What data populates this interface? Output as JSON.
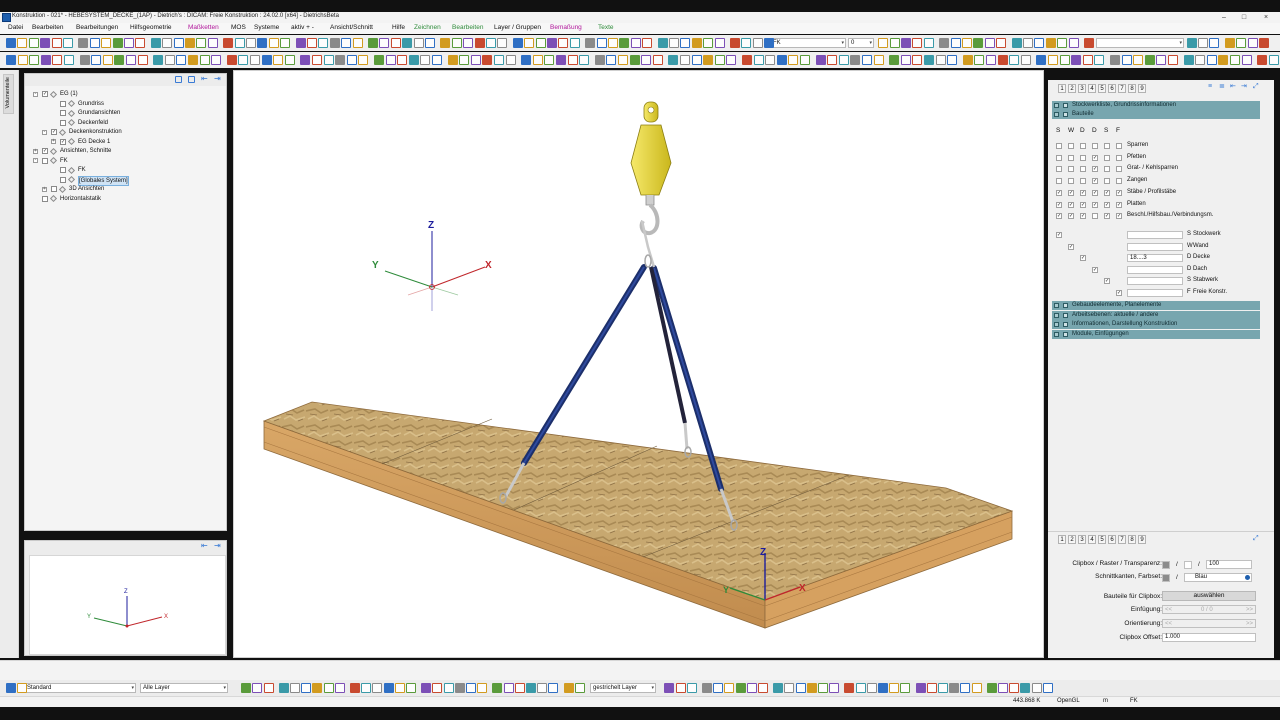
{
  "window": {
    "title": "Konstruktion - 021* - HEBESYSTEM_DECKE_(1AP) - Dietrich's : DICAM: Freie Konstruktion : 24.02.0 [x64] - DietrichsBeta",
    "minimize": "–",
    "maximize": "□",
    "close": "×"
  },
  "menu": [
    {
      "label": "Datei",
      "color": "#111111"
    },
    {
      "label": "Bearbeiten",
      "color": "#111111"
    },
    {
      "label": "Bearbeitungen",
      "color": "#111111"
    },
    {
      "label": "Hilfsgeometrie",
      "color": "#111111"
    },
    {
      "label": "Maßketten",
      "color": "#b0169a"
    },
    {
      "label": "MOS",
      "color": "#111111"
    },
    {
      "label": "Systeme",
      "color": "#111111"
    },
    {
      "label": "aktiv + -",
      "color": "#111111"
    },
    {
      "label": "Ansicht/Schnitt",
      "color": "#111111"
    },
    {
      "label": "Hilfe",
      "color": "#111111"
    },
    {
      "label": "Zeichnen",
      "color": "#2e8b3a"
    },
    {
      "label": "Bearbeiten",
      "color": "#2e8b3a"
    },
    {
      "label": "Layer / Gruppen",
      "color": "#111111"
    },
    {
      "label": "Bemaßung",
      "color": "#b0169a"
    },
    {
      "label": "Texte",
      "color": "#2e8b3a"
    }
  ],
  "toolbar": {
    "view_combo": "FK",
    "number_combo": "0"
  },
  "left_tab": "Volumenteile",
  "tree": [
    {
      "label": "EG (1)",
      "level": 0,
      "expand": "-",
      "checked": true
    },
    {
      "label": "Grundriss",
      "level": 2,
      "expand": "",
      "checked": false
    },
    {
      "label": "Grundansichten",
      "level": 2,
      "expand": "",
      "checked": false
    },
    {
      "label": "Deckenfeld",
      "level": 2,
      "expand": "",
      "checked": false
    },
    {
      "label": "Deckenkonstruktion",
      "level": 1,
      "expand": "-",
      "checked": true
    },
    {
      "label": "EG Decke 1",
      "level": 2,
      "expand": "+",
      "checked": true
    },
    {
      "label": "Ansichten, Schnitte",
      "level": 0,
      "expand": "+",
      "checked": true
    },
    {
      "label": "FK",
      "level": 0,
      "expand": "-",
      "checked": false
    },
    {
      "label": "FK",
      "level": 2,
      "expand": "",
      "checked": false
    },
    {
      "label": "[Globales System]",
      "level": 2,
      "expand": "",
      "checked": false,
      "selected": true
    },
    {
      "label": "3D Ansichten",
      "level": 1,
      "expand": "+",
      "checked": false
    },
    {
      "label": "Horizontalstatik",
      "level": 0,
      "expand": "",
      "checked": false
    }
  ],
  "axes": {
    "x": "X",
    "y": "Y",
    "z": "Z"
  },
  "right_panel": {
    "tabs": [
      "1",
      "2",
      "3",
      "4",
      "5",
      "6",
      "7",
      "8",
      "9"
    ],
    "groups_top": [
      "Stockwerkliste, Grundrissinformationen",
      "Bauteile"
    ],
    "col_headers": [
      "S",
      "W",
      "D",
      "D",
      "S",
      "F"
    ],
    "bauteile": [
      {
        "label": "Sparren",
        "checks": [
          false,
          false,
          false,
          false,
          false,
          false
        ]
      },
      {
        "label": "Pfetten",
        "checks": [
          false,
          false,
          false,
          true,
          false,
          false
        ]
      },
      {
        "label": "Grat- / Kehlsparren",
        "checks": [
          false,
          false,
          false,
          true,
          false,
          false
        ]
      },
      {
        "label": "Zangen",
        "checks": [
          false,
          false,
          false,
          true,
          false,
          false
        ]
      },
      {
        "label": "Stäbe / Profilstäbe",
        "checks": [
          true,
          true,
          true,
          true,
          true,
          true
        ]
      },
      {
        "label": "Platten",
        "checks": [
          true,
          true,
          true,
          true,
          true,
          true
        ]
      },
      {
        "label": "Beschl./Hilfsbau./Verbindungsm.",
        "checks": [
          true,
          true,
          true,
          false,
          true,
          true
        ]
      }
    ],
    "floors": [
      {
        "code": "S",
        "label": "Stockwerk",
        "value": ""
      },
      {
        "code": "W",
        "label": "Wand",
        "value": ""
      },
      {
        "code": "D",
        "label": "Decke",
        "value": "18....3"
      },
      {
        "code": "D",
        "label": "Dach",
        "value": ""
      },
      {
        "code": "S",
        "label": "Stabwerk",
        "value": ""
      },
      {
        "code": "F",
        "label": "Freie Konstr.",
        "value": ""
      }
    ],
    "groups_bottom": [
      "Gebaudeelemente, Planelemente",
      "Arbeitsebenen: aktuelle / andere",
      "Informationen, Darstellung Konstruktion",
      "Module, Einfügungen"
    ],
    "clip": {
      "clipbox_label": "Clipbox / Raster / Transparenz:",
      "sep": "/",
      "transparency": "100",
      "schnitt_label": "Schnittkanten, Farbset:",
      "farbset": "Blau",
      "bauteile_label": "Bauteile für Clipbox:",
      "bauteile_btn": "auswählen",
      "einfuegung_label": "Einfügung:",
      "einfuegung_value": "0 / 0",
      "orientierung_label": "Orientierung:",
      "offset_label": "Clipbox Offset:",
      "offset_value": "1.000",
      "arrow_left": "<<",
      "arrow_right": ">>"
    }
  },
  "bottom_toolbar": {
    "style_combo": "Standard",
    "layer_combo": "Alle Layer",
    "linetype_combo": "gestrichelt Layer"
  },
  "status": {
    "coord": "443.868 K",
    "renderer": "OpenGL",
    "unit": "m",
    "mode": "FK"
  }
}
